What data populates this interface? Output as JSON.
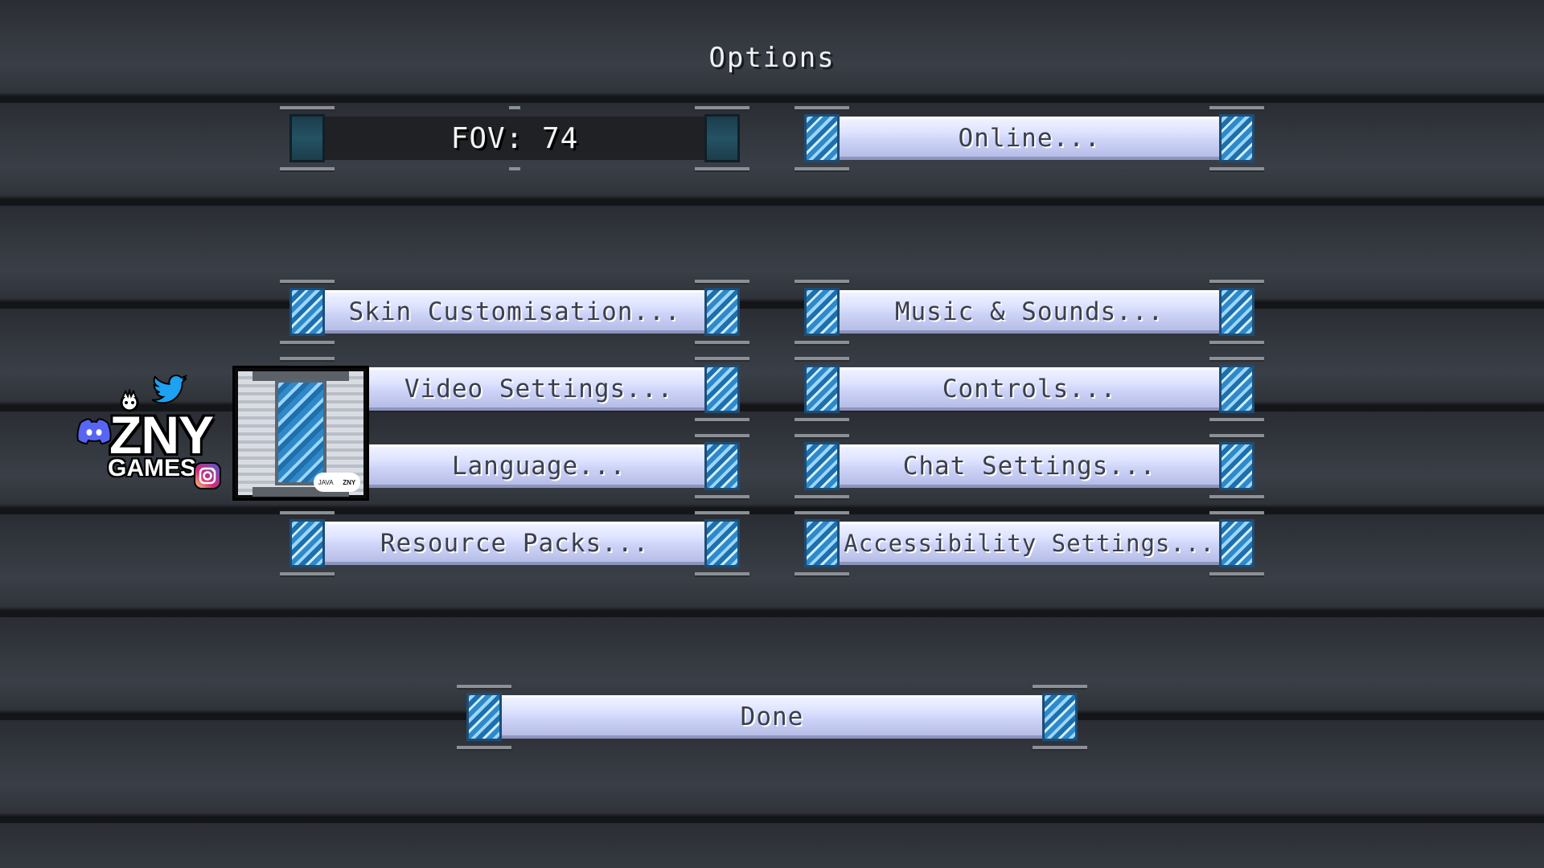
{
  "title": "Options",
  "fov_slider": {
    "label": "FOV: 74",
    "value": 74
  },
  "buttons": {
    "online": "Online...",
    "skin": "Skin Customisation...",
    "music": "Music & Sounds...",
    "video": "Video Settings...",
    "controls": "Controls...",
    "language": "Language...",
    "chat": "Chat Settings...",
    "resource": "Resource Packs...",
    "accessibility": "Accessibility Settings...",
    "done": "Done"
  },
  "overlay": {
    "brand": "ZNY",
    "brand_sub": "GAMES",
    "badge_left": "JAVA",
    "badge_right": "ZNY",
    "icons": [
      "discord-icon",
      "twitter-icon",
      "instagram-icon",
      "mascot-icon"
    ]
  },
  "colors": {
    "button_face": "#dfe4ff",
    "button_text": "#3b3f4c",
    "cap_crystal": "#2f89c9",
    "slider_face": "#1f2124",
    "discord": "#5865f2",
    "twitter": "#1da1f2"
  }
}
